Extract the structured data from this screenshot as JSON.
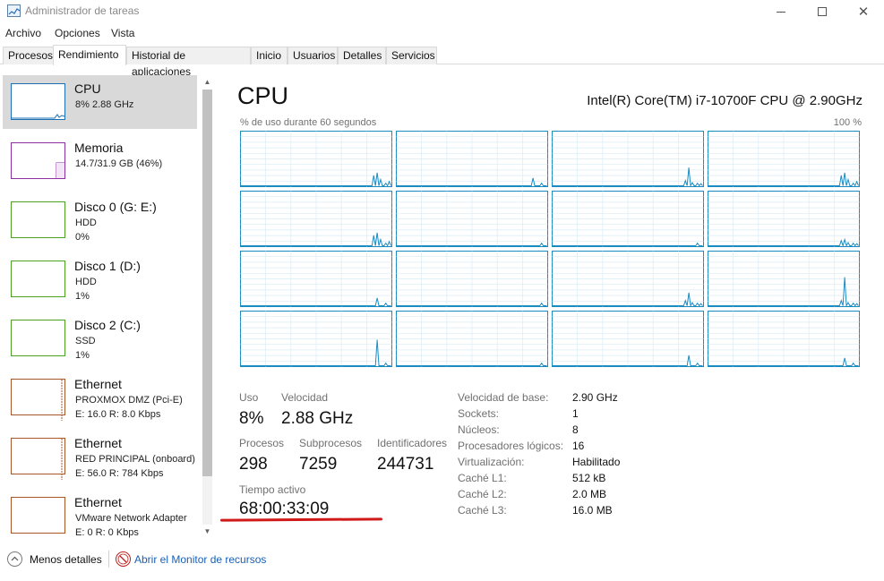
{
  "window": {
    "title": "Administrador de tareas"
  },
  "menu": [
    "Archivo",
    "Opciones",
    "Vista"
  ],
  "tabs": [
    "Procesos",
    "Rendimiento",
    "Historial de aplicaciones",
    "Inicio",
    "Usuarios",
    "Detalles",
    "Servicios"
  ],
  "active_tab": "Rendimiento",
  "sidebar": {
    "items": [
      {
        "title": "CPU",
        "line1": "8%  2.88 GHz",
        "line2": "",
        "color": "#1b6fb2"
      },
      {
        "title": "Memoria",
        "line1": "14.7/31.9 GB (46%)",
        "line2": "",
        "color": "#8b2fa3"
      },
      {
        "title": "Disco 0 (G: E:)",
        "line1": "HDD",
        "line2": "0%",
        "color": "#4da125"
      },
      {
        "title": "Disco 1 (D:)",
        "line1": "HDD",
        "line2": "1%",
        "color": "#4da125"
      },
      {
        "title": "Disco 2 (C:)",
        "line1": "SSD",
        "line2": "1%",
        "color": "#4da125"
      },
      {
        "title": "Ethernet",
        "line1": "PROXMOX DMZ (Pci-E)",
        "line2": "E: 16.0  R: 8.0 Kbps",
        "color": "#a7562a"
      },
      {
        "title": "Ethernet",
        "line1": "RED PRINCIPAL (onboard)",
        "line2": "E: 56.0  R: 784 Kbps",
        "color": "#a7562a"
      },
      {
        "title": "Ethernet",
        "line1": "VMware Network Adapter",
        "line2": "E: 0  R: 0 Kbps",
        "color": "#a7562a"
      }
    ]
  },
  "main": {
    "title": "CPU",
    "model": "Intel(R) Core(TM) i7-10700F CPU @ 2.90GHz",
    "axis_label": "% de uso durante 60 segundos",
    "axis_max": "100 %",
    "graph_color": "#1b8cc2",
    "core_peaks": [
      [
        0.2,
        0.25,
        0.0
      ],
      [
        0.0,
        0.15,
        0.0
      ],
      [
        0.1,
        0.35,
        0.0
      ],
      [
        0.2,
        0.25,
        0.0
      ],
      [
        0.2,
        0.25,
        0.0
      ],
      [
        0.0,
        0.0,
        0.0
      ],
      [
        0.0,
        0.0,
        0.0
      ],
      [
        0.1,
        0.12,
        0.0
      ],
      [
        0.0,
        0.15,
        0.0
      ],
      [
        0.0,
        0.0,
        0.0
      ],
      [
        0.1,
        0.25,
        0.0
      ],
      [
        0.1,
        0.55,
        0.0
      ],
      [
        0.0,
        0.5,
        0.0
      ],
      [
        0.0,
        0.0,
        0.0
      ],
      [
        0.0,
        0.2,
        0.0
      ],
      [
        0.0,
        0.15,
        0.0
      ]
    ],
    "stats": {
      "uso_label": "Uso",
      "uso_value": "8%",
      "velocidad_label": "Velocidad",
      "velocidad_value": "2.88 GHz",
      "procesos_label": "Procesos",
      "procesos_value": "298",
      "subprocesos_label": "Subprocesos",
      "subprocesos_value": "7259",
      "identificadores_label": "Identificadores",
      "identificadores_value": "244731",
      "tiempo_label": "Tiempo activo",
      "tiempo_value": "68:00:33:09"
    },
    "info": [
      {
        "label": "Velocidad de base:",
        "value": "2.90 GHz"
      },
      {
        "label": "Sockets:",
        "value": "1"
      },
      {
        "label": "Núcleos:",
        "value": "8"
      },
      {
        "label": "Procesadores lógicos:",
        "value": "16"
      },
      {
        "label": "Virtualización:",
        "value": "Habilitado"
      },
      {
        "label": "Caché L1:",
        "value": "512 kB"
      },
      {
        "label": "Caché L2:",
        "value": "2.0 MB"
      },
      {
        "label": "Caché L3:",
        "value": "16.0 MB"
      }
    ]
  },
  "footer": {
    "less_details": "Menos detalles",
    "resource_monitor": "Abrir el Monitor de recursos"
  }
}
